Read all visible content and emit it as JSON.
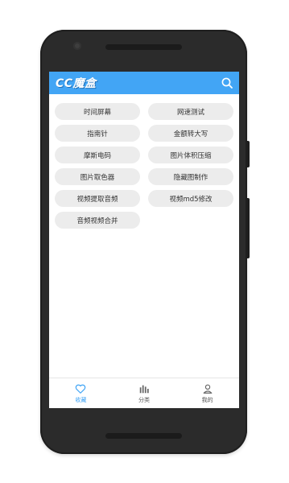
{
  "app": {
    "title": "CC魔盒"
  },
  "tools": [
    {
      "label": "时间屏幕"
    },
    {
      "label": "网速测试"
    },
    {
      "label": "指南针"
    },
    {
      "label": "金额转大写"
    },
    {
      "label": "摩斯电码"
    },
    {
      "label": "图片体积压缩"
    },
    {
      "label": "图片取色器"
    },
    {
      "label": "隐藏图制作"
    },
    {
      "label": "视频提取音频"
    },
    {
      "label": "视频md5修改"
    },
    {
      "label": "音频视频合并"
    }
  ],
  "bottom_nav": [
    {
      "label": "收藏",
      "icon": "heart-icon",
      "active": true
    },
    {
      "label": "分类",
      "icon": "bar-chart-icon",
      "active": false
    },
    {
      "label": "我的",
      "icon": "person-icon",
      "active": false
    }
  ],
  "colors": {
    "accent": "#42a5f5",
    "chip_bg": "#ececec",
    "device": "#2b2b2b"
  }
}
